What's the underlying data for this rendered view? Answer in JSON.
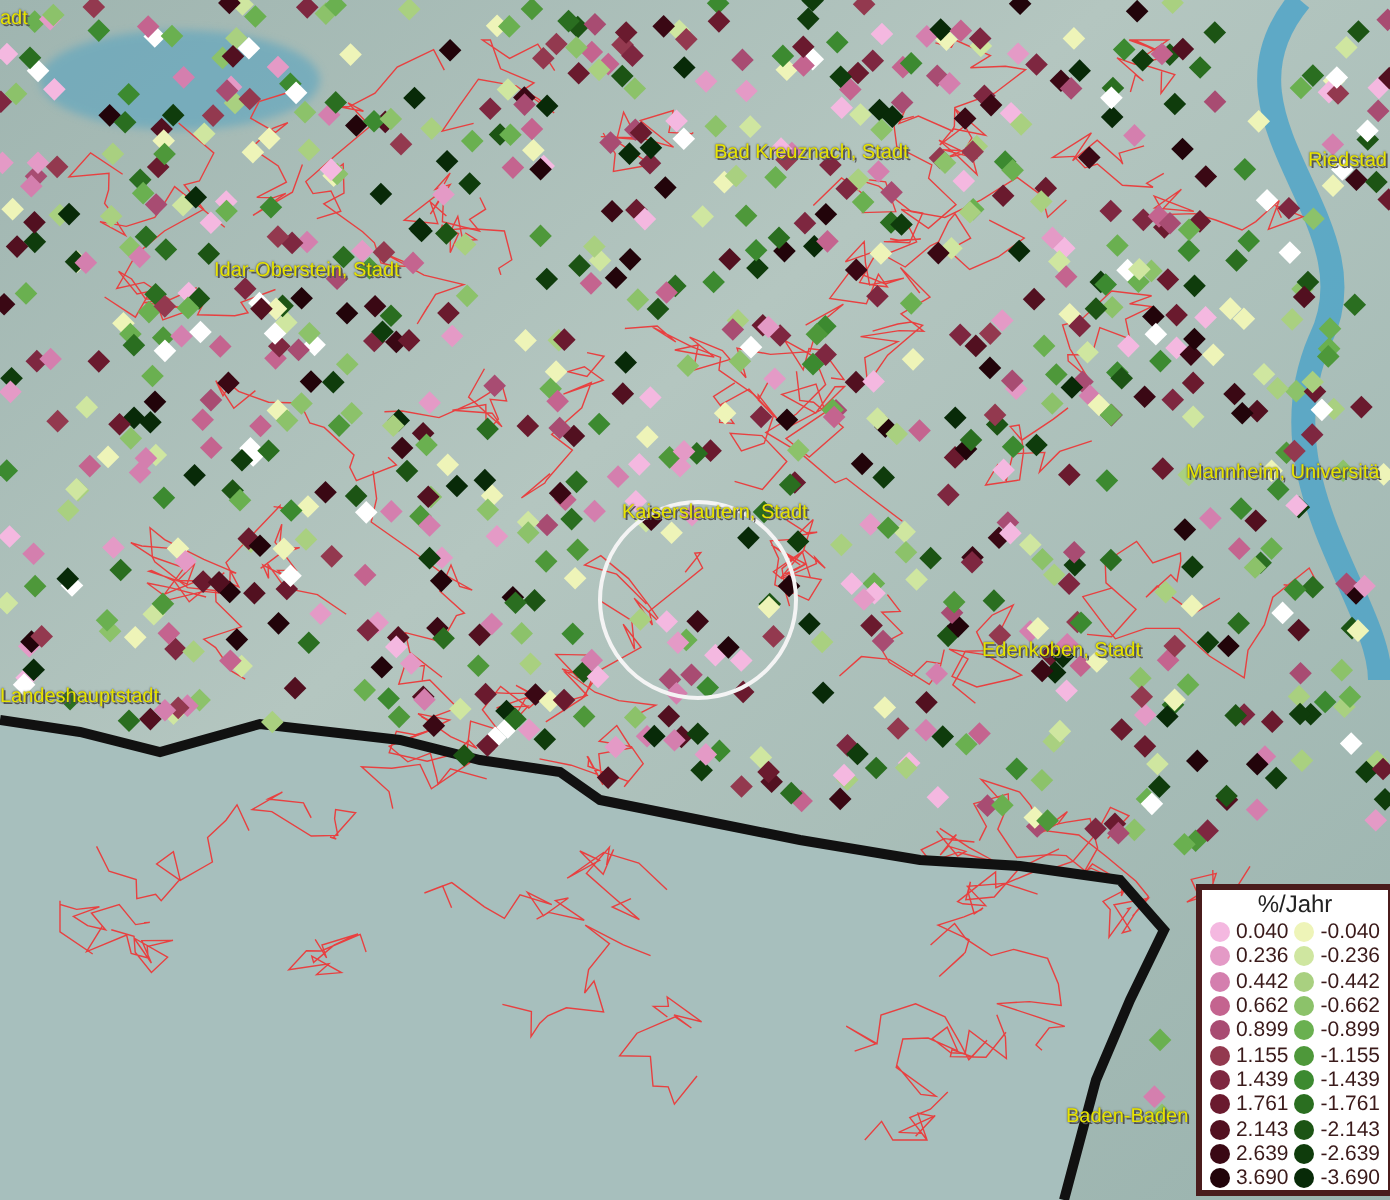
{
  "map": {
    "place_labels": [
      "adt",
      "Bad Kreuznach, Stadt",
      "Riedstad",
      "Idar-Oberstein, Stadt",
      "Mannheim, Universitä",
      "Kaiserslautern, Stadt",
      "Edenkoben, Stadt",
      "Landeshauptstadt",
      "Baden-Baden"
    ]
  },
  "legend": {
    "title": "%/Jahr",
    "rows": [
      {
        "positive": {
          "label": "0.040",
          "color": "#f4b8e0"
        },
        "negative": {
          "label": "-0.040",
          "color": "#eef4b8"
        }
      },
      {
        "positive": {
          "label": "0.236",
          "color": "#e49ac6"
        },
        "negative": {
          "label": "-0.236",
          "color": "#cfe6a0"
        }
      },
      {
        "positive": {
          "label": "0.442",
          "color": "#d47fae"
        },
        "negative": {
          "label": "-0.442",
          "color": "#a9d080"
        }
      },
      {
        "positive": {
          "label": "0.662",
          "color": "#c4648f"
        },
        "negative": {
          "label": "-0.662",
          "color": "#8cc26a"
        }
      },
      {
        "positive": {
          "label": "0.899",
          "color": "#a84c72"
        },
        "negative": {
          "label": "-0.899",
          "color": "#6ab050"
        }
      },
      {
        "positive": {
          "label": "1.155",
          "color": "#93394f"
        },
        "negative": {
          "label": "-1.155",
          "color": "#4e983a"
        }
      },
      {
        "positive": {
          "label": "1.439",
          "color": "#7e2740"
        },
        "negative": {
          "label": "-1.439",
          "color": "#3c8a30"
        }
      },
      {
        "positive": {
          "label": "1.761",
          "color": "#6a1a2e"
        },
        "negative": {
          "label": "-1.761",
          "color": "#2a6e20"
        }
      },
      {
        "positive": {
          "label": "2.143",
          "color": "#521020"
        },
        "negative": {
          "label": "-2.143",
          "color": "#1c5414"
        }
      },
      {
        "positive": {
          "label": "2.639",
          "color": "#3a0814"
        },
        "negative": {
          "label": "-2.639",
          "color": "#0f3c0c"
        }
      },
      {
        "positive": {
          "label": "3.690",
          "color": "#22040a"
        },
        "negative": {
          "label": "-3.690",
          "color": "#082a08"
        }
      }
    ]
  }
}
